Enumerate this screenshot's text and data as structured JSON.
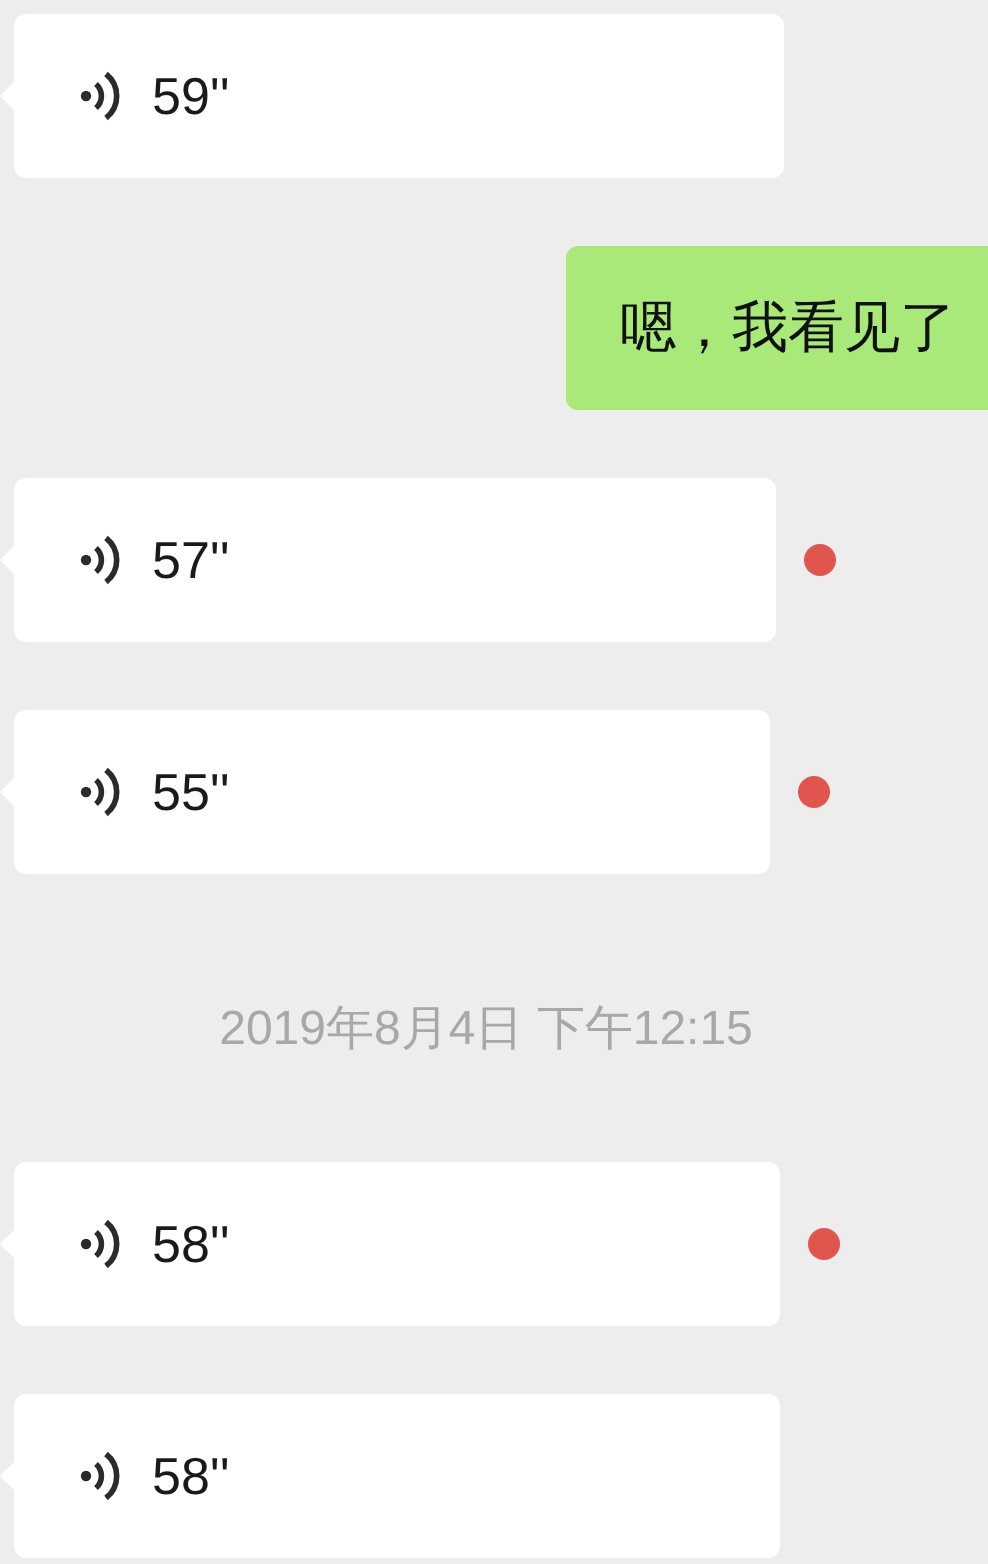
{
  "messages": [
    {
      "kind": "voice",
      "outgoing": false,
      "duration": "59''",
      "unread": false
    },
    {
      "kind": "text",
      "outgoing": true,
      "text": "嗯，我看见了"
    },
    {
      "kind": "voice",
      "outgoing": false,
      "duration": "57''",
      "unread": true
    },
    {
      "kind": "voice",
      "outgoing": false,
      "duration": "55''",
      "unread": true
    },
    {
      "kind": "timestamp",
      "text": "2019年8月4日 下午12:15"
    },
    {
      "kind": "voice",
      "outgoing": false,
      "duration": "58''",
      "unread": true
    },
    {
      "kind": "voice",
      "outgoing": false,
      "duration": "58''",
      "unread": false
    }
  ]
}
